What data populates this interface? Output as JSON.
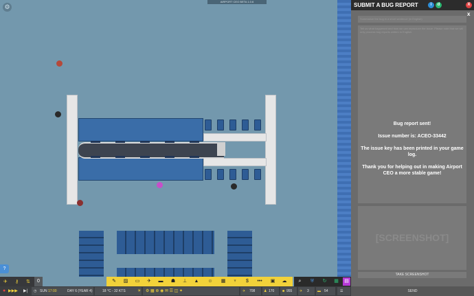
{
  "game": {
    "version": "AIRPORT CEO BETA 1.0.6",
    "settings_icon": "gear-icon",
    "help_label": "?"
  },
  "bug_report": {
    "title": "SUBMIT A BUG REPORT",
    "info_label": "i",
    "discord_label": "d",
    "close_label": "X",
    "secondary_close_label": "x",
    "title_placeholder": "Summarize the bug in a short sentence (in English)",
    "description_placeholder": "Tell us what happened and how we can reproduce the issue. Please note that we will only process bug reports written in English.",
    "message_lines": [
      "Bug report sent!",
      "",
      "Issue number is: ACEO-33442",
      "",
      "The issue key has been printed in your game log.",
      "",
      "Thank you for helping out in making Airport CEO a more stable game!"
    ],
    "screenshot_placeholder": "[SCREENSHOT]",
    "take_screenshot_label": "TAKE SCREENSHOT",
    "send_label": "SEND"
  },
  "statusbar": {
    "money": "0",
    "day": "SUN",
    "time": "17:00",
    "day_year": "DAY 6 (YEAR 4)",
    "weather": "18 °C - 32 KTS",
    "flights": "708",
    "staff": "170",
    "passengers": "955",
    "planes": "3",
    "gates": "54"
  },
  "icons": {
    "toolbar": [
      "runway-icon",
      "zone-icon",
      "vehicle-icon",
      "aircraft-icon",
      "bench-icon",
      "staff-icon",
      "structure-icon",
      "security-icon",
      "person-icon",
      "baggage-icon",
      "food-icon",
      "finance-icon",
      "more-icon",
      "cargo-icon",
      "weather-icon"
    ],
    "toolbar2": [
      "search-icon",
      "shield-icon",
      "refresh-icon",
      "grid-icon",
      "purple-icon"
    ]
  },
  "colors": {
    "ground": "#7398ad",
    "panel": "#6b6b6b",
    "toolbar": "#f2d23a",
    "close": "#e04343",
    "info": "#2e8fd8",
    "discord": "#2db872"
  }
}
